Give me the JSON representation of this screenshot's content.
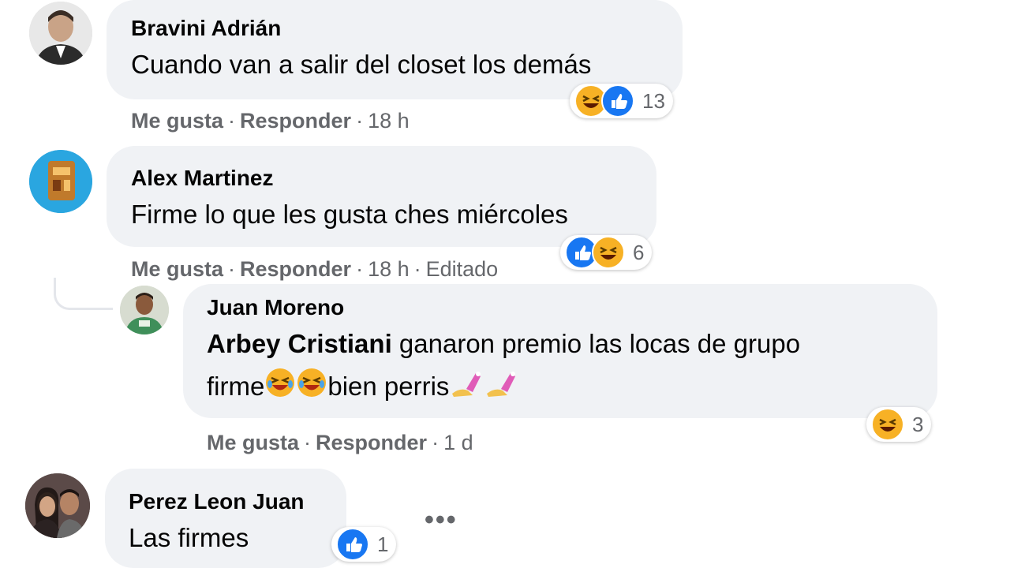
{
  "comments": [
    {
      "author": "Bravini Adrián",
      "text": "Cuando van a salir del closet los demás",
      "actions": {
        "like": "Me gusta",
        "reply": "Responder",
        "time": "18 h"
      },
      "reactions": {
        "icons": [
          "haha",
          "like"
        ],
        "count": "13"
      }
    },
    {
      "author": "Alex Martinez",
      "text": "Firme lo que les gusta ches miércoles",
      "actions": {
        "like": "Me gusta",
        "reply": "Responder",
        "time": "18 h",
        "edited": "Editado"
      },
      "reactions": {
        "icons": [
          "like",
          "haha"
        ],
        "count": "6"
      }
    },
    {
      "author": "Juan Moreno",
      "mention": "Arbey Cristiani",
      "text_line1": "ganaron premio las locas de grupo",
      "text_line2_start": "firme",
      "text_line2_end": "bien perris",
      "actions": {
        "like": "Me gusta",
        "reply": "Responder",
        "time": "1 d"
      },
      "reactions": {
        "icons": [
          "haha"
        ],
        "count": "3"
      }
    },
    {
      "author": "Perez Leon Juan",
      "text": "Las firmes",
      "reactions": {
        "icons": [
          "like"
        ],
        "count": "1"
      },
      "more": "•••"
    }
  ],
  "separator": "·",
  "colors": {
    "bubble": "#f0f2f5",
    "like": "#1877f2",
    "haha": "#f7b125",
    "meta": "#65676b"
  },
  "icons": {
    "like": "thumbs-up-icon",
    "haha": "laughing-face-icon",
    "rofl": "rolling-laughing-emoji",
    "nails": "nail-polish-emoji"
  }
}
